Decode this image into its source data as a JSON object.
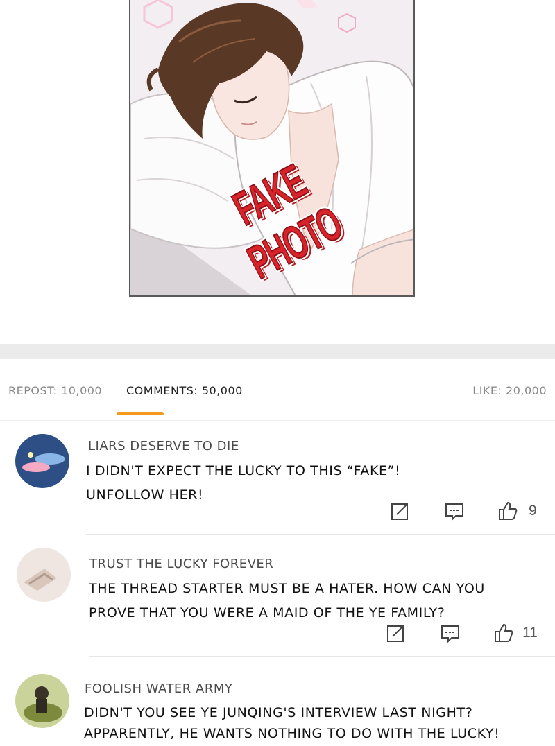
{
  "panel": {
    "stamp_text": "FAKE PHOTO"
  },
  "stats": {
    "repost": "REPOST: 10,000",
    "comments": "COMMENTS: 50,000",
    "like": "LIKE: 20,000",
    "active_tab_color": "#f39a1e"
  },
  "comments": [
    {
      "username": "LIARS DESERVE TO DIE",
      "lines": [
        "I DIDN'T EXPECT THE LUCKY TO THIS “FAKE”!",
        "UNFOLLOW HER!"
      ],
      "likes": "9"
    },
    {
      "username": "TRUST THE LUCKY FOREVER",
      "lines": [
        "THE THREAD STARTER MUST BE A HATER. HOW CAN YOU",
        "PROVE THAT YOU WERE A MAID OF THE YE FAMILY?"
      ],
      "likes": "11"
    },
    {
      "username": "FOOLISH WATER ARMY",
      "lines": [
        "DIDN'T YOU SEE YE JUNQING'S INTERVIEW LAST NIGHT?",
        "APPARENTLY, HE WANTS NOTHING TO DO WITH THE LUCKY!"
      ]
    }
  ],
  "icons": {
    "repost": "share-edit-icon",
    "reply": "comment-bubble-icon",
    "like": "thumbs-up-icon"
  }
}
